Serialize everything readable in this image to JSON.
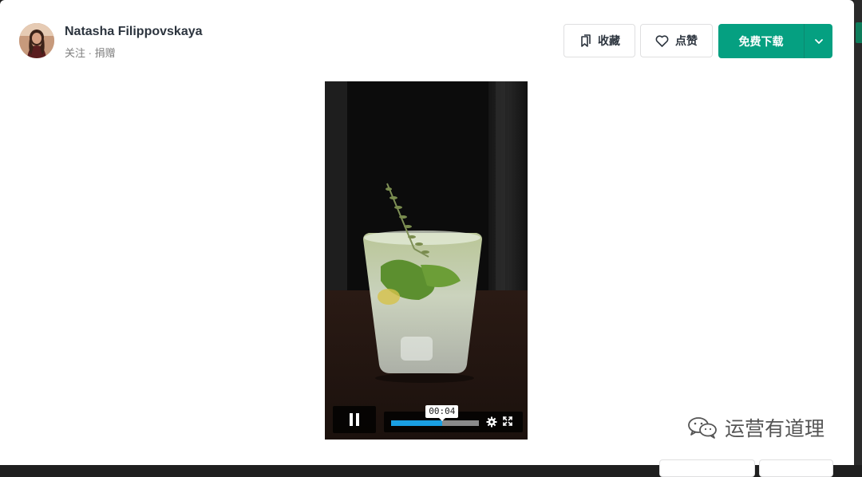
{
  "author": {
    "name": "Natasha Filippovskaya",
    "follow_label": "关注",
    "separator": " · ",
    "donate_label": "捐赠",
    "avatar_icon": "avatar-photo"
  },
  "toolbar": {
    "collect_label": "收藏",
    "collect_icon": "bookmark-icon",
    "like_label": "点赞",
    "like_icon": "heart-icon",
    "download_label": "免费下载",
    "download_menu_icon": "chevron-down-icon"
  },
  "player": {
    "current_time": "00:04",
    "progress_fraction": 0.58,
    "state": "playing",
    "pause_icon": "pause-icon",
    "settings_icon": "gear-icon",
    "fullscreen_icon": "fullscreen-icon"
  },
  "watermark": {
    "text": "运营有道理",
    "icon": "wechat-icon"
  },
  "colors": {
    "brand_green": "#05a081",
    "progress_blue": "#1aa0e3",
    "text_dark": "#2c343e",
    "text_muted": "#7f7f7f"
  }
}
